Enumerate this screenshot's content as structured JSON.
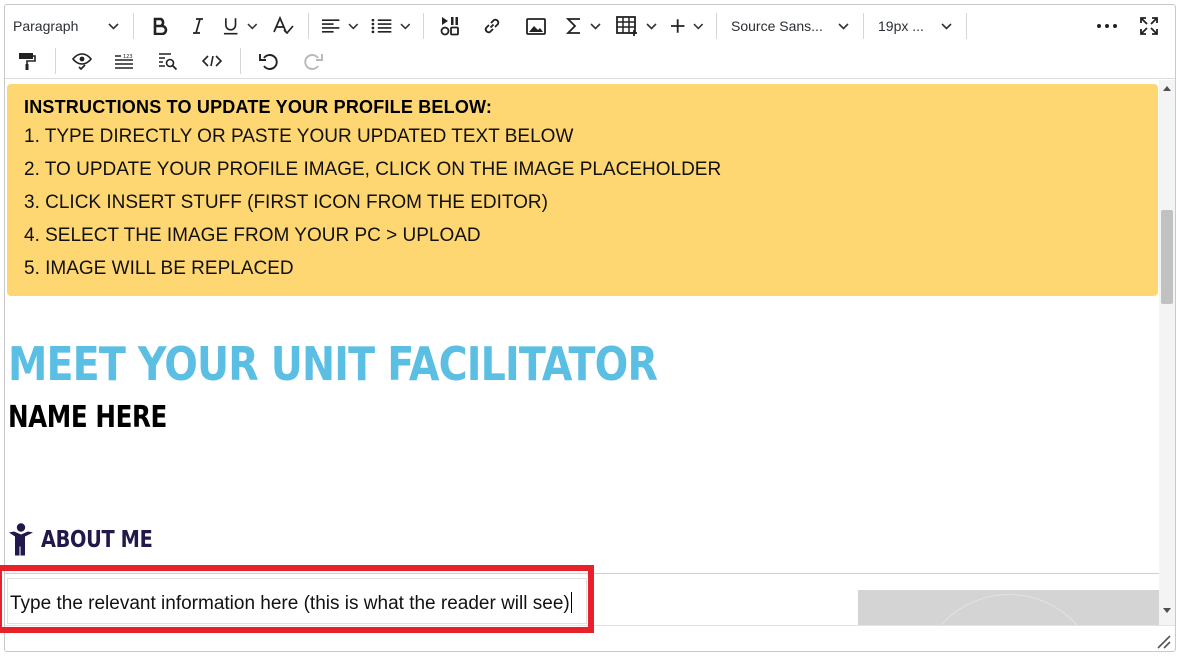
{
  "toolbar": {
    "block_format": "Paragraph",
    "font_family": "Source Sans...",
    "font_size": "19px ...",
    "icons": [
      "bold-icon",
      "italic-icon",
      "underline-icon",
      "format-painter-icon",
      "align-icon",
      "list-icon",
      "insert-stuff-icon",
      "link-icon",
      "image-icon",
      "equation-icon",
      "table-icon",
      "plus-icon",
      "more-icon",
      "fullscreen-icon",
      "paint-roller-icon",
      "accessibility-check-icon",
      "word-count-icon",
      "find-replace-icon",
      "source-code-icon",
      "undo-icon",
      "redo-icon"
    ]
  },
  "notice": {
    "heading": "INSTRUCTIONS TO UPDATE YOUR PROFILE BELOW:",
    "steps": [
      "1. TYPE DIRECTLY OR PASTE YOUR UPDATED TEXT BELOW",
      "2. TO UPDATE YOUR PROFILE IMAGE, CLICK ON THE IMAGE PLACEHOLDER",
      "3. CLICK INSERT STUFF (FIRST ICON FROM THE EDITOR)",
      "4. SELECT THE IMAGE FROM YOUR PC > UPLOAD",
      "5. IMAGE WILL BE REPLACED"
    ]
  },
  "content": {
    "main_heading": "MEET YOUR UNIT FACILITATOR",
    "name_heading": "NAME HERE",
    "about_label": "ABOUT ME",
    "body_text": "Type the relevant information here (this is what the reader will see)"
  },
  "colors": {
    "notice_bg": "#fed672",
    "heading_blue": "#5bbee3",
    "about_navy": "#22184a",
    "highlight_red": "#e8202a"
  }
}
